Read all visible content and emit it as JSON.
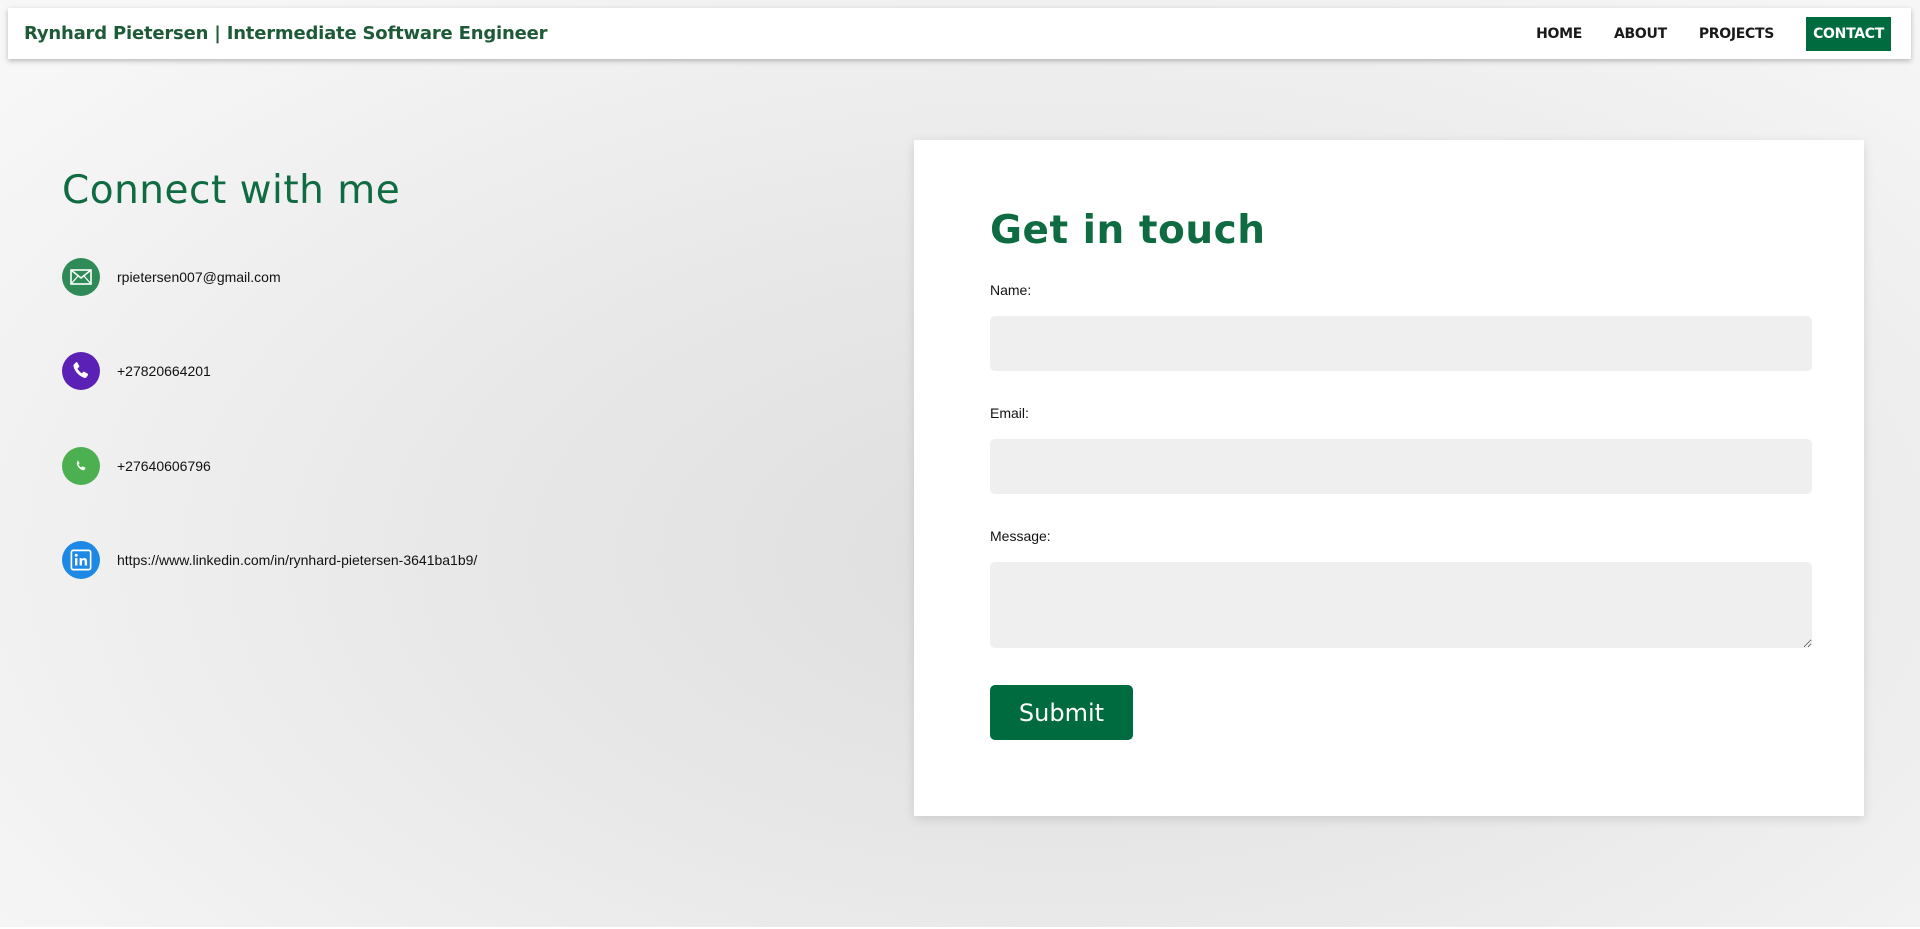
{
  "navbar": {
    "brand": "Rynhard Pietersen | Intermediate Software Engineer",
    "links": [
      {
        "label": "HOME",
        "active": false
      },
      {
        "label": "ABOUT",
        "active": false
      },
      {
        "label": "PROJECTS",
        "active": false
      },
      {
        "label": "CONTACT",
        "active": true
      }
    ]
  },
  "connect": {
    "title": "Connect with me",
    "items": [
      {
        "icon": "email-icon",
        "text": "rpietersen007@gmail.com",
        "color": "#2e8b57"
      },
      {
        "icon": "phone-icon",
        "text": "+27820664201",
        "color": "#5b21b6"
      },
      {
        "icon": "whatsapp-icon",
        "text": "+27640606796",
        "color": "#4caf50"
      },
      {
        "icon": "linkedin-icon",
        "text": "https://www.linkedin.com/in/rynhard-pietersen-3641ba1b9/",
        "color": "#1e88e5"
      }
    ]
  },
  "form": {
    "title": "Get in touch",
    "name_label": "Name:",
    "name_value": "",
    "email_label": "Email:",
    "email_value": "",
    "message_label": "Message:",
    "message_value": "",
    "submit_label": "Submit"
  },
  "colors": {
    "brand_green": "#1e5a38",
    "accent_green": "#006b3f",
    "heading_green": "#0f6b42",
    "input_bg": "#efefef"
  }
}
